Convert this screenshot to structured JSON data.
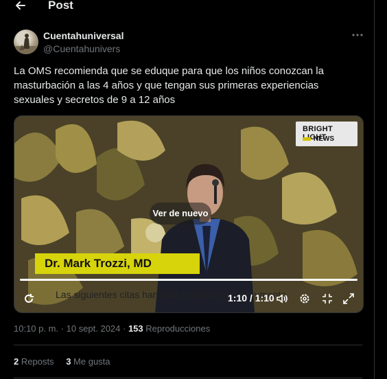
{
  "header": {
    "title": "Post",
    "back_icon": "arrow-left-icon"
  },
  "author": {
    "name": "Cuentahuniversal",
    "handle": "@Cuentahunivers",
    "more_icon": "more-dots-icon"
  },
  "tweet": {
    "text": "La OMS recomienda que se eduque para que los niños conozcan  la\nmasturbación a las 4 años y que tengan sus primeras  experiencias\nsexuales y secretos de 9 a 12 años"
  },
  "video": {
    "logo_line1": "BRIGHT LIGHT",
    "logo_line2": "NEWS",
    "replay_label": "Ver de nuevo",
    "lower_third": "Dr. Mark Trozzi, MD",
    "subtitle": "Las siguientes citas han sido extraídas del documento",
    "time": "1:10 / 1:10",
    "progress": 1.0,
    "icons": [
      "replay-icon",
      "volume-icon",
      "settings-icon",
      "fullscreen-exit-icon",
      "expand-icon"
    ]
  },
  "meta": {
    "timestamp": "10:10 p. m. · 10 sept. 2024 · ",
    "views_count": "153",
    "views_label": "Reproducciones"
  },
  "stats": {
    "reposts_count": "2",
    "reposts_label": "Reposts",
    "likes_count": "3",
    "likes_label": "Me gusta"
  },
  "colors": {
    "background": "#000000",
    "text": "#e7e9ea",
    "secondary": "#71767b",
    "divider": "#2f3336",
    "lower_third": "#d7d40b"
  }
}
